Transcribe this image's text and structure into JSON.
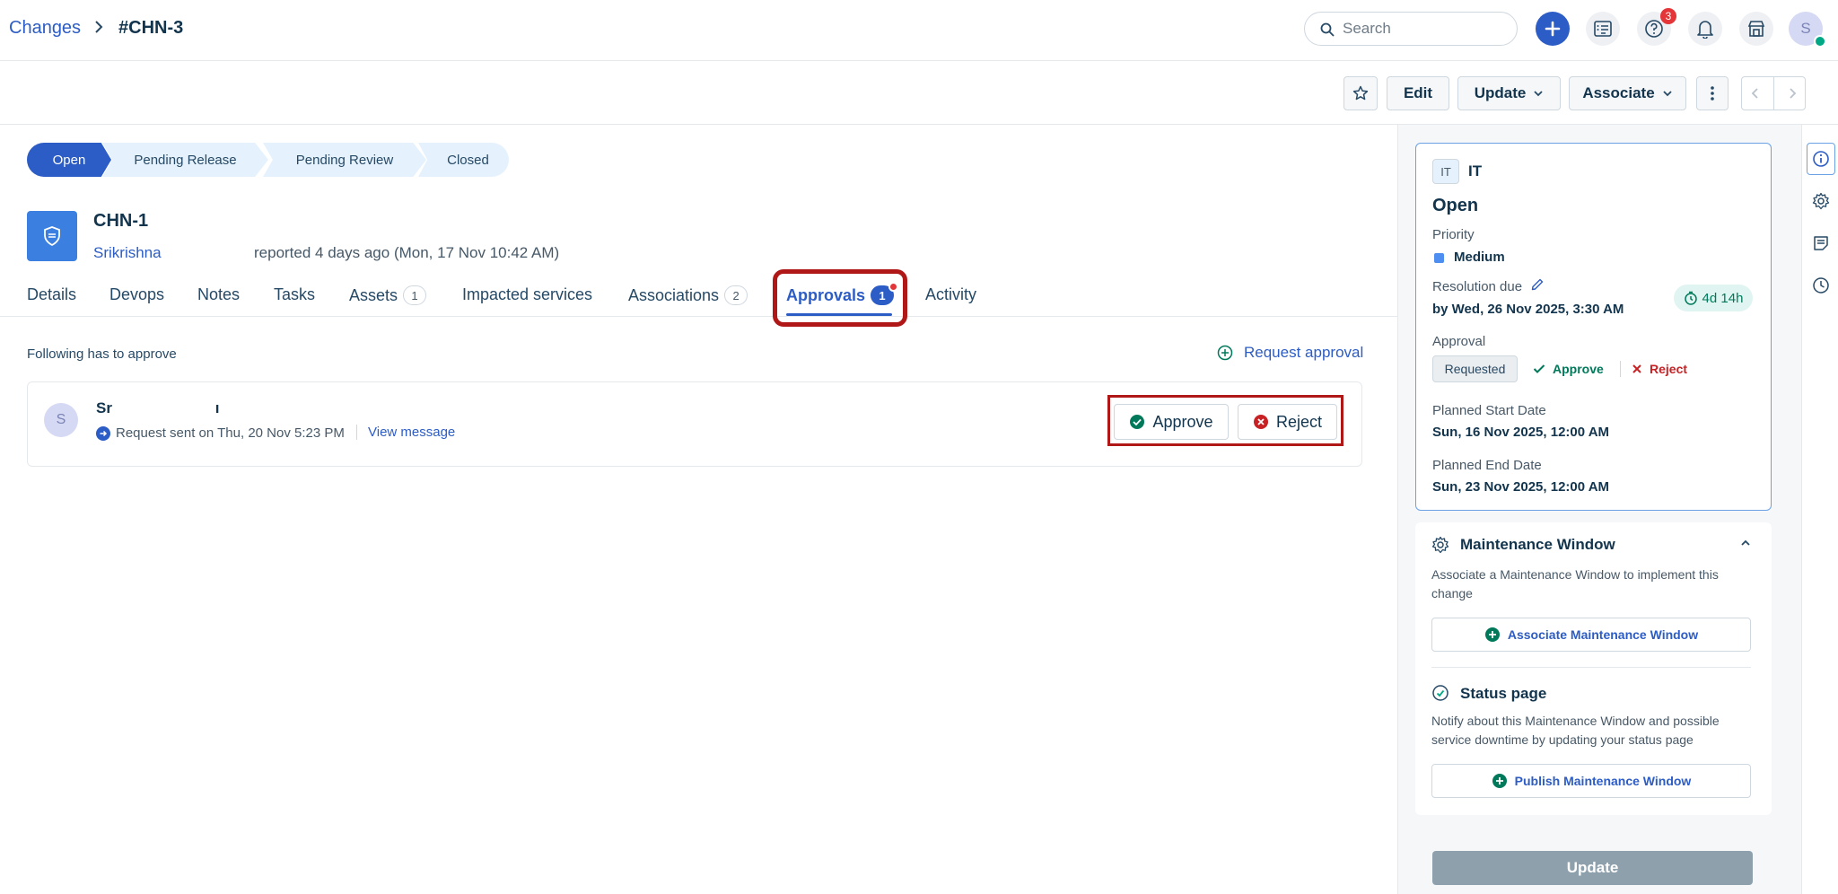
{
  "header": {
    "breadcrumb_link": "Changes",
    "breadcrumb_current": "#CHN-3",
    "search_placeholder": "Search",
    "help_badge_count": "3",
    "user_initial": "S"
  },
  "toolbar": {
    "edit_label": "Edit",
    "update_label": "Update",
    "associate_label": "Associate"
  },
  "workflow": {
    "steps": [
      "Open",
      "Pending Release",
      "Pending Review",
      "Closed"
    ]
  },
  "ticket": {
    "id": "CHN-1",
    "reporter": "Srikrishna",
    "reported_text": "reported 4 days ago (Mon, 17 Nov 10:42 AM)"
  },
  "tabs": [
    {
      "label": "Details"
    },
    {
      "label": "Devops"
    },
    {
      "label": "Notes"
    },
    {
      "label": "Tasks"
    },
    {
      "label": "Assets",
      "count": "1"
    },
    {
      "label": "Impacted services"
    },
    {
      "label": "Associations",
      "count": "2"
    },
    {
      "label": "Approvals",
      "count": "1"
    },
    {
      "label": "Activity"
    }
  ],
  "approvals": {
    "heading": "Following has to approve",
    "request_approval_label": "Request approval",
    "card": {
      "avatar_initial": "S",
      "name": "Sr",
      "name_tail": "ı",
      "request_sent": "Request sent on Thu, 20 Nov 5:23 PM",
      "view_message": "View message",
      "approve_label": "Approve",
      "reject_label": "Reject"
    }
  },
  "details_panel": {
    "group_tag": "IT",
    "group_name": "IT",
    "status": "Open",
    "priority_label": "Priority",
    "priority_value": "Medium",
    "resolution_label": "Resolution due",
    "resolution_value": "by Wed, 26 Nov 2025, 3:30 AM",
    "sla_remaining": "4d 14h",
    "approval_label": "Approval",
    "approval_status": "Requested",
    "approve_label": "Approve",
    "reject_label": "Reject",
    "planned_start_label": "Planned Start Date",
    "planned_start_value": "Sun, 16 Nov 2025, 12:00 AM",
    "planned_end_label": "Planned End Date",
    "planned_end_value": "Sun, 23 Nov 2025, 12:00 AM"
  },
  "maintenance_window": {
    "title": "Maintenance Window",
    "description": "Associate a Maintenance Window to implement this change",
    "associate_button": "Associate Maintenance Window",
    "status_page_title": "Status page",
    "status_page_description": "Notify about this Maintenance Window and possible service downtime by updating your status page",
    "publish_button": "Publish Maintenance Window"
  },
  "footer": {
    "update_button": "Update"
  },
  "colors": {
    "primary": "#2c5cc5",
    "success": "#00795b",
    "danger": "#c82124",
    "highlight": "#b01818"
  },
  "icons": [
    "search-icon",
    "plus-icon",
    "ticket-list-icon",
    "help-icon",
    "bell-icon",
    "store-icon",
    "star-icon",
    "more-icon",
    "chevron-left-icon",
    "chevron-right-icon",
    "shield-icon",
    "info-icon",
    "gear-icon",
    "notes-icon",
    "clock-icon",
    "timer-icon",
    "pencil-icon"
  ]
}
